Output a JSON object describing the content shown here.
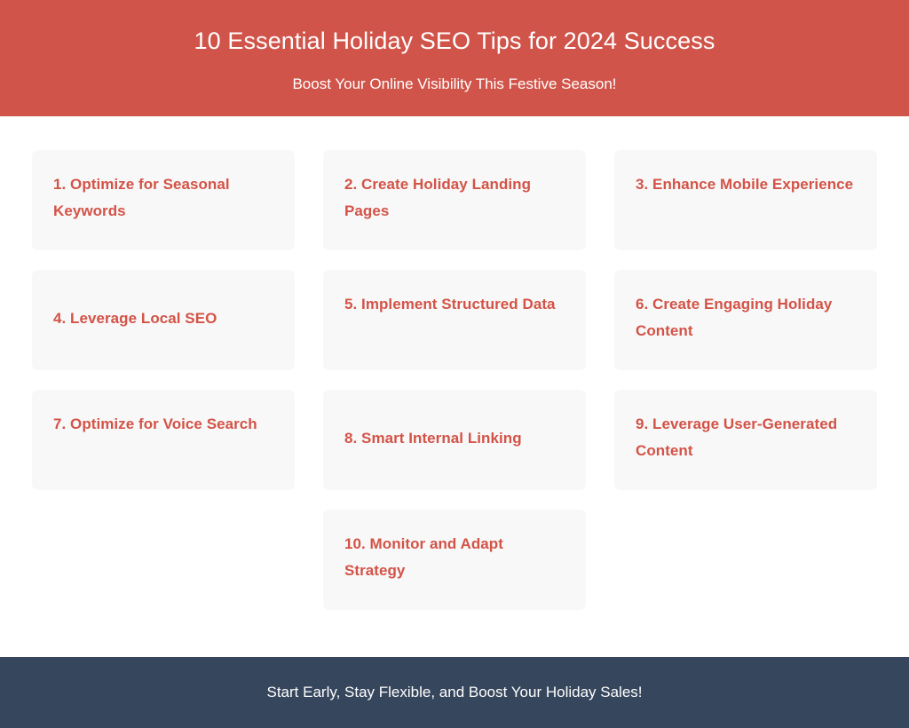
{
  "header": {
    "title": "10 Essential Holiday SEO Tips for 2024 Success",
    "subtitle": "Boost Your Online Visibility This Festive Season!",
    "background_color": "#d1544a",
    "text_color": "#ffffff"
  },
  "main": {
    "card_background_color": "#f8f8f8",
    "card_text_color": "#d35347",
    "tips": [
      {
        "text": "1. Optimize for Seasonal Keywords"
      },
      {
        "text": "2. Create Holiday Landing Pages"
      },
      {
        "text": "3. Enhance Mobile Experience"
      },
      {
        "text": "4. Leverage Local SEO"
      },
      {
        "text": "5. Implement Structured Data"
      },
      {
        "text": "6. Create Engaging Holiday Content"
      },
      {
        "text": "7. Optimize for Voice Search"
      },
      {
        "text": "8. Smart Internal Linking"
      },
      {
        "text": "9. Leverage User-Generated Content"
      },
      {
        "text": "10. Monitor and Adapt Strategy"
      }
    ]
  },
  "footer": {
    "text": "Start Early, Stay Flexible, and Boost Your Holiday Sales!",
    "background_color": "#36465c",
    "text_color": "#ffffff"
  }
}
